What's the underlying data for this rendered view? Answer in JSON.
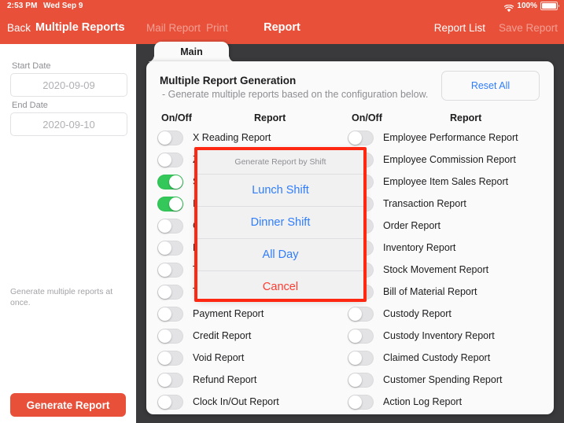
{
  "statusbar": {
    "time": "2:53 PM",
    "date": "Wed Sep 9",
    "battery_pct": "100%",
    "wifi_icon": "wifi-icon",
    "battery_icon": "battery-icon"
  },
  "navbar": {
    "back_label": "Back",
    "left_title": "Multiple Reports",
    "mail_report_label": "Mail Report",
    "print_label": "Print",
    "center_title": "Report",
    "report_list_label": "Report List",
    "save_report_label": "Save Report"
  },
  "sidebar": {
    "start_date_label": "Start Date",
    "start_date_value": "2020-09-09",
    "end_date_label": "End Date",
    "end_date_value": "2020-09-10",
    "description": "Generate multiple reports at once.",
    "generate_button_label": "Generate Report"
  },
  "panel": {
    "tab_label": "Main",
    "title": "Multiple Report Generation",
    "subtitle": "- Generate multiple reports based on the configuration below.",
    "reset_label": "Reset All",
    "col_onoff_left": "On/Off",
    "col_report_left": "Report",
    "col_onoff_right": "On/Off",
    "col_report_right": "Report"
  },
  "reports_left": [
    {
      "label": "X Reading Report",
      "on": false
    },
    {
      "label": "Z Reading Report",
      "on": false
    },
    {
      "label": "Sales Report",
      "on": true
    },
    {
      "label": "Item Sales Report",
      "on": true
    },
    {
      "label": "Category Sales Report",
      "on": false
    },
    {
      "label": "Discount Report",
      "on": false
    },
    {
      "label": "Tax Report",
      "on": false
    },
    {
      "label": "Tip Report",
      "on": false
    },
    {
      "label": "Payment Report",
      "on": false
    },
    {
      "label": "Credit Report",
      "on": false
    },
    {
      "label": "Void Report",
      "on": false
    },
    {
      "label": "Refund Report",
      "on": false
    },
    {
      "label": "Clock In/Out Report",
      "on": false
    }
  ],
  "reports_right": [
    {
      "label": "Employee Performance Report",
      "on": false
    },
    {
      "label": "Employee Commission Report",
      "on": false
    },
    {
      "label": "Employee Item Sales Report",
      "on": false
    },
    {
      "label": "Transaction Report",
      "on": false
    },
    {
      "label": "Order Report",
      "on": false
    },
    {
      "label": "Inventory Report",
      "on": false
    },
    {
      "label": "Stock Movement Report",
      "on": false
    },
    {
      "label": "Bill of Material Report",
      "on": false
    },
    {
      "label": "Custody Report",
      "on": false
    },
    {
      "label": "Custody Inventory Report",
      "on": false
    },
    {
      "label": "Claimed Custody Report",
      "on": false
    },
    {
      "label": "Customer Spending Report",
      "on": false
    },
    {
      "label": "Action Log Report",
      "on": false
    }
  ],
  "action_sheet": {
    "title": "Generate Report by Shift",
    "options": [
      "Lunch Shift",
      "Dinner Shift",
      "All Day"
    ],
    "cancel_label": "Cancel"
  },
  "colors": {
    "brand_red": "#e8503a",
    "highlight_red": "#fe2712",
    "toggle_on_green": "#34c759",
    "link_blue": "#2f7dfd",
    "cancel_red": "#ff3b30"
  }
}
